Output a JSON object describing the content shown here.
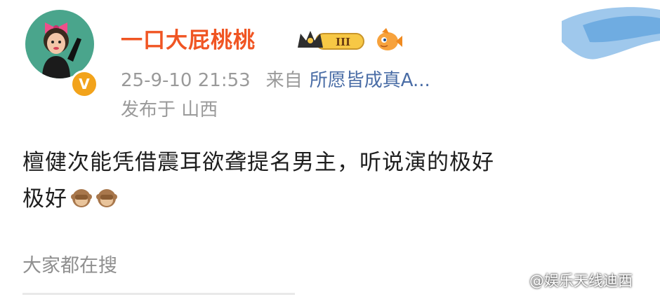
{
  "post": {
    "username": "一口大屁桃桃",
    "timestamp": "25-9-10 21:53",
    "source_label": "来自",
    "source_name": "所愿皆成真A...",
    "location": "发布于 山西",
    "text_line1": "檀健次能凭借震耳欲聋提名男主，听说演的极好",
    "text_line2": "极好",
    "emoji": "see-no-evil-monkey",
    "vip_level": "III"
  },
  "search": {
    "label": "大家都在搜"
  },
  "watermark": {
    "text": "@娱乐天线迪西"
  },
  "colors": {
    "username": "#f05523",
    "source_link": "#4a6da6",
    "meta": "#9a9a9a",
    "avatar_bg": "#4aa58c",
    "verified": "#f2a31b"
  }
}
